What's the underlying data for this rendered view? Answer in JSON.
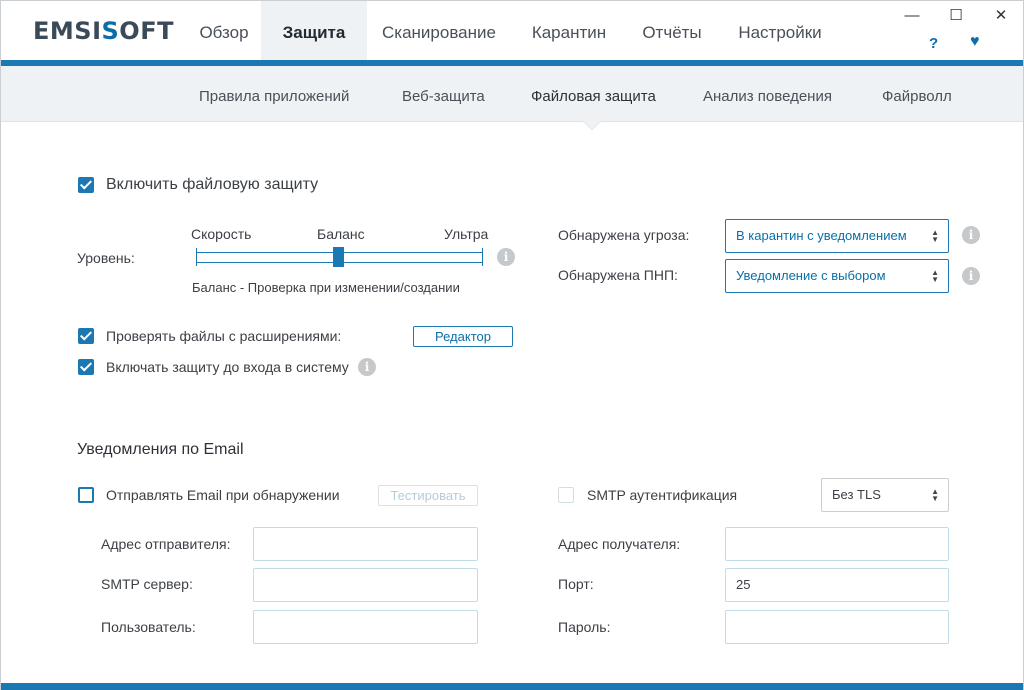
{
  "logo": {
    "prefix": "EMSI",
    "accent": "S",
    "suffix": "OFT"
  },
  "main_tabs": [
    {
      "label": "Обзор"
    },
    {
      "label": "Защита"
    },
    {
      "label": "Сканирование"
    },
    {
      "label": "Карантин"
    },
    {
      "label": "Отчёты"
    },
    {
      "label": "Настройки"
    }
  ],
  "window": {
    "minimize": "—",
    "maximize": "☐",
    "close": "✕",
    "help": "?",
    "heart": "♥"
  },
  "sub_tabs": [
    {
      "label": "Правила приложений"
    },
    {
      "label": "Веб-защита"
    },
    {
      "label": "Файловая защита"
    },
    {
      "label": "Анализ поведения"
    },
    {
      "label": "Файрволл"
    }
  ],
  "file_protection": {
    "enable_label": "Включить файловую защиту",
    "enabled": true,
    "level_label": "Уровень:",
    "slider": {
      "labels": [
        "Скорость",
        "Баланс",
        "Ультра"
      ],
      "value": "Баланс",
      "description": "Баланс - Проверка при изменении/создании"
    },
    "check_extensions_label": "Проверять файлы с расширениями:",
    "check_extensions": true,
    "editor_button": "Редактор",
    "preboot_label": "Включать защиту до входа в систему",
    "preboot": true,
    "threat_label": "Обнаружена угроза:",
    "threat_value": "В карантин с уведомлением",
    "pup_label": "Обнаружена ПНП:",
    "pup_value": "Уведомление с выбором"
  },
  "email": {
    "title": "Уведомления по Email",
    "send_label": "Отправлять Email при обнаружении",
    "send": false,
    "test_button": "Тестировать",
    "smtp_auth_label": "SMTP аутентификация",
    "smtp_auth": false,
    "tls_value": "Без TLS",
    "sender_label": "Адрес отправителя:",
    "sender_value": "",
    "server_label": "SMTP сервер:",
    "server_value": "",
    "user_label": "Пользователь:",
    "user_value": "",
    "recipient_label": "Адрес получателя:",
    "recipient_value": "",
    "port_label": "Порт:",
    "port_value": "25",
    "password_label": "Пароль:",
    "password_value": ""
  },
  "colors": {
    "accent": "#1b78b3",
    "subnav_bg": "#eef2f4"
  }
}
